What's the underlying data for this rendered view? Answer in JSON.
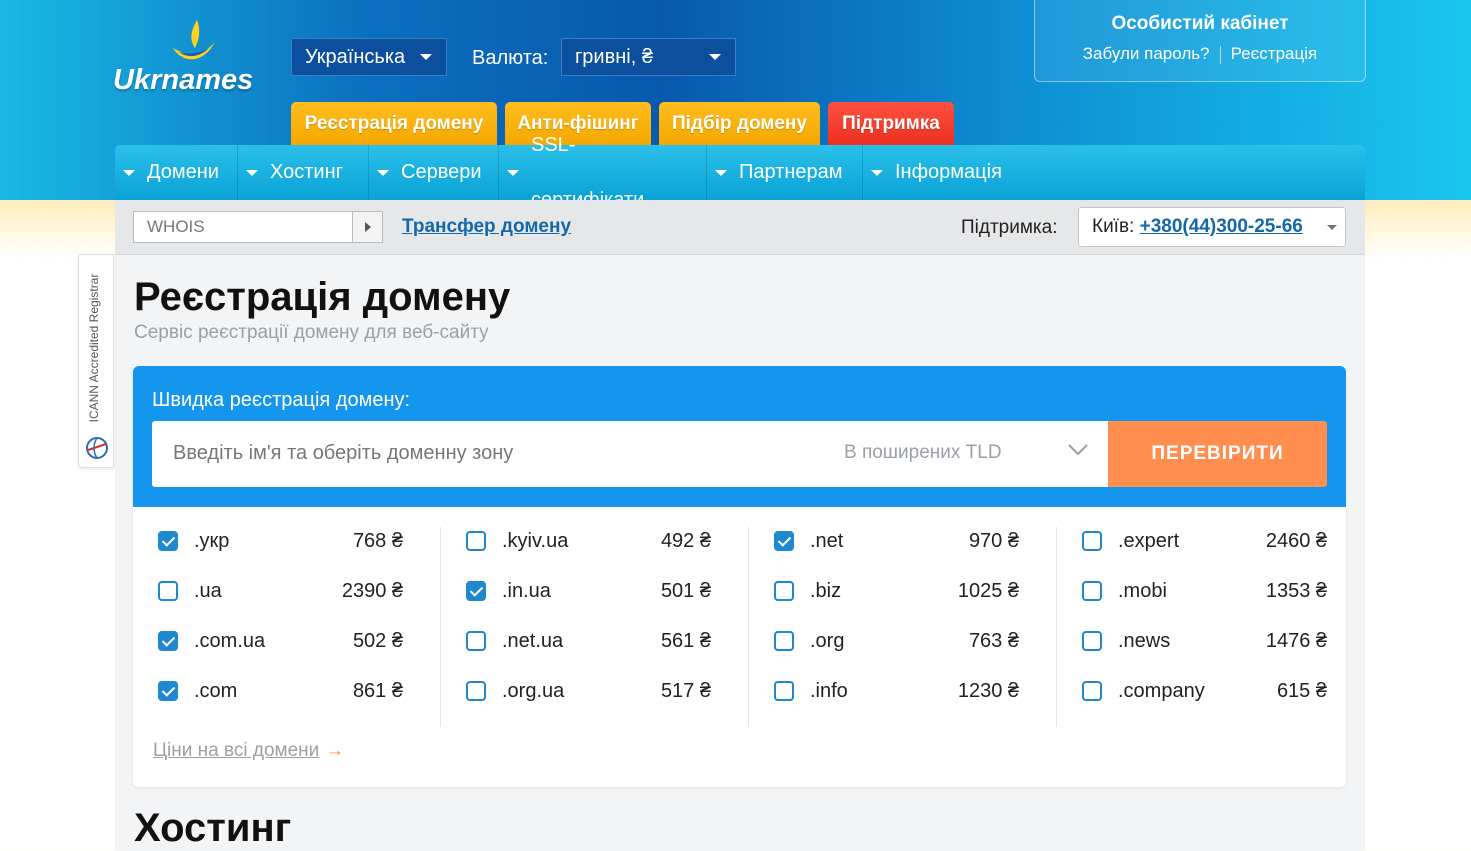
{
  "header": {
    "brand": "Ukrnames",
    "language": "Українська",
    "currency_label": "Валюта:",
    "currency": "гривні, ₴",
    "account": {
      "title": "Особистий кабінет",
      "forgot": "Забули пароль?",
      "register": "Реєстрація"
    },
    "tabs": [
      {
        "label": "Реєстрація домену",
        "color": "#f5a800"
      },
      {
        "label": "Анти-фішинг",
        "color": "#f5a800"
      },
      {
        "label": "Підбір домену",
        "color": "#f5a800"
      },
      {
        "label": "Підтримка",
        "color": "#ed3020"
      }
    ]
  },
  "nav": {
    "items": [
      "Домени",
      "Хостинг",
      "Сервери",
      "SSL-сертифікати",
      "Партнерам",
      "Інформація"
    ]
  },
  "subbar": {
    "whois_placeholder": "WHOIS",
    "transfer": "Трансфер домену",
    "support_label": "Підтримка:",
    "city": "Київ:",
    "phone": "+380(44)300-25-66"
  },
  "badge": {
    "text": "ICANN Accredited Registrar"
  },
  "page": {
    "title": "Реєстрація домену",
    "subtitle": "Сервіс реєстрації домену для веб-сайту"
  },
  "quick": {
    "label": "Швидка реєстрація домену:",
    "placeholder": "Введіть ім'я та оберіть доменну зону",
    "tld_select": "В поширених TLD",
    "button": "ПЕРЕВІРИТИ",
    "all_prices": "Ціни на всі домени",
    "arrow": "→"
  },
  "zones": [
    [
      {
        "zone": ".укр",
        "price": "768 ₴",
        "checked": true
      },
      {
        "zone": ".ua",
        "price": "2390 ₴",
        "checked": false
      },
      {
        "zone": ".com.ua",
        "price": "502 ₴",
        "checked": true
      },
      {
        "zone": ".com",
        "price": "861 ₴",
        "checked": true
      }
    ],
    [
      {
        "zone": ".kyiv.ua",
        "price": "492 ₴",
        "checked": false
      },
      {
        "zone": ".in.ua",
        "price": "501 ₴",
        "checked": true
      },
      {
        "zone": ".net.ua",
        "price": "561 ₴",
        "checked": false
      },
      {
        "zone": ".org.ua",
        "price": "517 ₴",
        "checked": false
      }
    ],
    [
      {
        "zone": ".net",
        "price": "970 ₴",
        "checked": true
      },
      {
        "zone": ".biz",
        "price": "1025 ₴",
        "checked": false
      },
      {
        "zone": ".org",
        "price": "763 ₴",
        "checked": false
      },
      {
        "zone": ".info",
        "price": "1230 ₴",
        "checked": false
      }
    ],
    [
      {
        "zone": ".expert",
        "price": "2460 ₴",
        "checked": false
      },
      {
        "zone": ".mobi",
        "price": "1353 ₴",
        "checked": false
      },
      {
        "zone": ".news",
        "price": "1476 ₴",
        "checked": false
      },
      {
        "zone": ".company",
        "price": "615 ₴",
        "checked": false
      }
    ]
  ],
  "next_section": {
    "title": "Хостинг"
  },
  "colors": {
    "accent_blue": "#1496ee",
    "check_orange": "#ff8e4f",
    "nav_cyan": "#0aa2d6",
    "link_blue": "#1468a8"
  }
}
